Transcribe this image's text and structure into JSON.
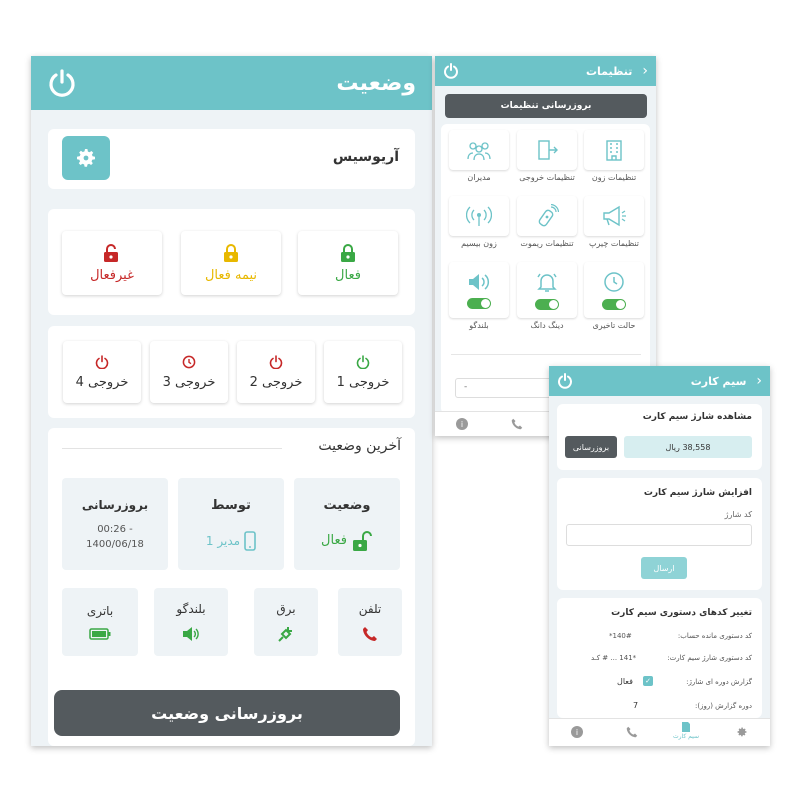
{
  "status_screen": {
    "title": "وضعیت",
    "device_name": "آریوسیس",
    "modes": [
      {
        "label": "فعال",
        "color": "#3aa845",
        "icon": "lock-closed-icon"
      },
      {
        "label": "نیمه فعال",
        "color": "#e8b800",
        "icon": "lock-closed-icon"
      },
      {
        "label": "غیرفعال",
        "color": "#c62828",
        "icon": "lock-open-icon"
      }
    ],
    "outputs": [
      {
        "label": "خروجی 1",
        "color": "#3aa845",
        "icon": "power-icon"
      },
      {
        "label": "خروجی 2",
        "color": "#c62828",
        "icon": "power-icon"
      },
      {
        "label": "خروجی 3",
        "color": "#c62828",
        "icon": "clock-icon"
      },
      {
        "label": "خروجی 4",
        "color": "#c62828",
        "icon": "power-icon"
      }
    ],
    "last_status": {
      "heading": "آخرین وضعیت",
      "status_label": "وضعیت",
      "status_value": "فعال",
      "by_label": "توسط",
      "by_value": "مدیر 1",
      "update_label": "بروزرسانی",
      "update_time": "00:26 -",
      "update_date": "1400/06/18"
    },
    "indicators": [
      {
        "label": "تلفن",
        "icon": "phone-icon",
        "color": "#c62828"
      },
      {
        "label": "برق",
        "icon": "plug-icon",
        "color": "#3aa845"
      },
      {
        "label": "بلندگو",
        "icon": "speaker-icon",
        "color": "#3aa845"
      },
      {
        "label": "باتری",
        "icon": "battery-icon",
        "color": "#3aa845"
      }
    ],
    "update_button": "بروزرسانی وضعیت"
  },
  "settings_screen": {
    "title": "تنظیمات",
    "update_button": "بروزرسانی تنظیمات",
    "items": [
      {
        "label": "تنظیمات زون",
        "icon": "building-icon"
      },
      {
        "label": "تنظیمات خروجی",
        "icon": "exit-door-icon"
      },
      {
        "label": "مدیران",
        "icon": "users-icon"
      },
      {
        "label": "تنظیمات چیرپ",
        "icon": "megaphone-icon"
      },
      {
        "label": "تنظیمات ریموت",
        "icon": "remote-icon"
      },
      {
        "label": "زون بیسیم",
        "icon": "wireless-icon"
      },
      {
        "label": "حالت تاخیری",
        "icon": "clock-icon"
      },
      {
        "label": "دینگ دانگ",
        "icon": "bell-icon"
      },
      {
        "label": "بلندگو",
        "icon": "speaker-icon"
      }
    ],
    "select_value": "-"
  },
  "sim_screen": {
    "title": "سیم کارت",
    "balance_heading": "مشاهده شارژ سیم کارت",
    "balance_value": "38,558 ریال",
    "balance_button": "بروزرسانی",
    "charge_heading": "افزایش شارژ سیم کارت",
    "charge_code_label": "کد شارژ",
    "send_button": "ارسال",
    "codes_heading": "تغییر کدهای دستوری سیم کارت",
    "balance_code_label": "کد دستوری مانده حساب:",
    "balance_code_value": "*140#",
    "charge_code_cmd_label": "کد دستوری شارژ سیم کارت:",
    "charge_code_cmd_value": "*141 ... # کـد",
    "report_label": "گزارش دوره ای شارژ:",
    "report_value": "فعال",
    "period_label": "دوره گزارش (روز):",
    "period_value": "7",
    "nav_active": "سیم کارت"
  }
}
